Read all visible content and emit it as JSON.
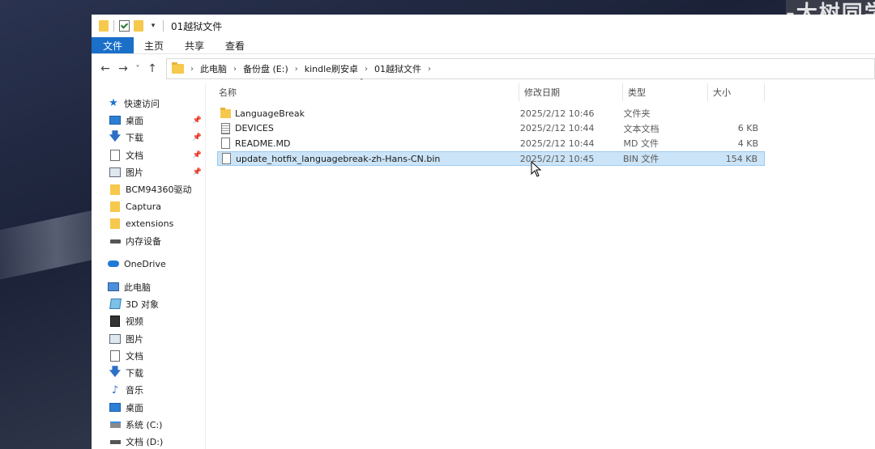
{
  "watermark": "-大树同学-",
  "window": {
    "title": "01越狱文件",
    "ribbon_tabs": [
      "文件",
      "主页",
      "共享",
      "查看"
    ]
  },
  "address": {
    "breadcrumbs": [
      "此电脑",
      "备份盘 (E:)",
      "kindle刷安卓",
      "01越狱文件"
    ]
  },
  "nav": {
    "quick_access": "快速访问",
    "quick_items": [
      {
        "label": "桌面",
        "icon": "desktop-icon",
        "pinned": true
      },
      {
        "label": "下载",
        "icon": "download-icon",
        "pinned": true
      },
      {
        "label": "文档",
        "icon": "document-icon",
        "pinned": true
      },
      {
        "label": "图片",
        "icon": "picture-icon",
        "pinned": true
      },
      {
        "label": "BCM94360驱动",
        "icon": "folder-icon",
        "pinned": false
      },
      {
        "label": "Captura",
        "icon": "folder-icon",
        "pinned": false
      },
      {
        "label": "extensions",
        "icon": "folder-icon",
        "pinned": false
      },
      {
        "label": "内存设备",
        "icon": "drive-icon",
        "pinned": false
      }
    ],
    "onedrive": "OneDrive",
    "this_pc": "此电脑",
    "pc_items": [
      {
        "label": "3D 对象",
        "icon": "3d-objects-icon"
      },
      {
        "label": "视频",
        "icon": "video-icon"
      },
      {
        "label": "图片",
        "icon": "picture-icon"
      },
      {
        "label": "文档",
        "icon": "document-icon"
      },
      {
        "label": "下载",
        "icon": "download-icon"
      },
      {
        "label": "音乐",
        "icon": "music-icon"
      },
      {
        "label": "桌面",
        "icon": "desktop-icon"
      },
      {
        "label": "系统 (C:)",
        "icon": "system-drive-icon"
      },
      {
        "label": "文档 (D:)",
        "icon": "drive-icon"
      }
    ]
  },
  "columns": {
    "name": "名称",
    "date": "修改日期",
    "type": "类型",
    "size": "大小"
  },
  "files": [
    {
      "name": "LanguageBreak",
      "date": "2025/2/12 10:46",
      "type": "文件夹",
      "size": "",
      "icon": "folder-icon",
      "selected": false
    },
    {
      "name": "DEVICES",
      "date": "2025/2/12 10:44",
      "type": "文本文档",
      "size": "6 KB",
      "icon": "text-file-icon",
      "selected": false
    },
    {
      "name": "README.MD",
      "date": "2025/2/12 10:44",
      "type": "MD 文件",
      "size": "4 KB",
      "icon": "file-icon",
      "selected": false
    },
    {
      "name": "update_hotfix_languagebreak-zh-Hans-CN.bin",
      "date": "2025/2/12 10:45",
      "type": "BIN 文件",
      "size": "154 KB",
      "icon": "file-icon",
      "selected": true
    }
  ],
  "colors": {
    "accent": "#1a6fc9",
    "selection": "#cce4f7",
    "folder": "#f6c84c"
  }
}
